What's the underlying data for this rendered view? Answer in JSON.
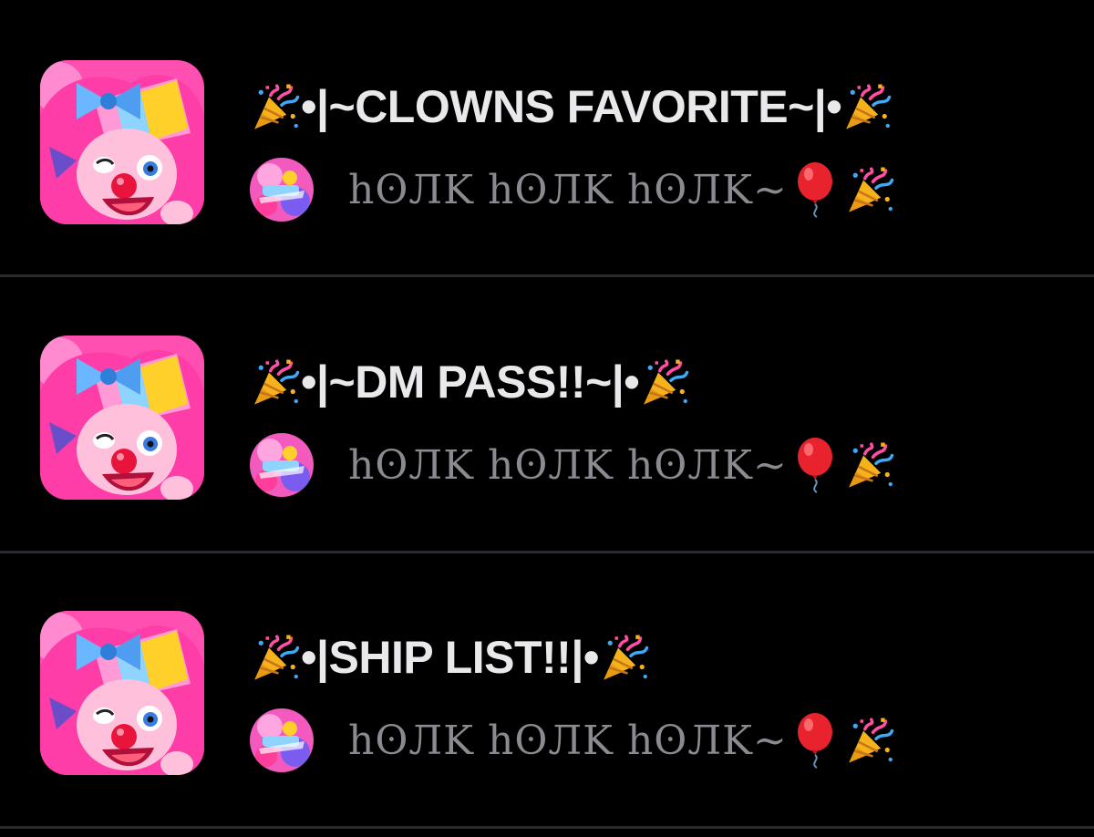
{
  "chats": [
    {
      "title_prefix": "•|~",
      "title": "CLOWNS FAVORITE",
      "title_suffix": "~|•",
      "preview": "hʘЛK hʘЛK hʘЛK~",
      "icons": [
        "party-popper-icon",
        "balloon-icon"
      ]
    },
    {
      "title_prefix": "•|~",
      "title": "DM PASS!!",
      "title_suffix": "~|•",
      "preview": "hʘЛK hʘЛK hʘЛK~",
      "icons": [
        "party-popper-icon",
        "balloon-icon"
      ]
    },
    {
      "title_prefix": "•|",
      "title": "SHIP LIST!!",
      "title_suffix": "|•",
      "preview": "hʘЛK hʘЛK hʘЛK~",
      "icons": [
        "party-popper-icon",
        "balloon-icon"
      ]
    }
  ],
  "colors": {
    "background": "#000000",
    "title": "#e9e9ec",
    "preview": "#8a8b90",
    "divider": "#2a2a2e",
    "avatar_pink": "#ff3da8",
    "balloon_red": "#e8232e"
  }
}
